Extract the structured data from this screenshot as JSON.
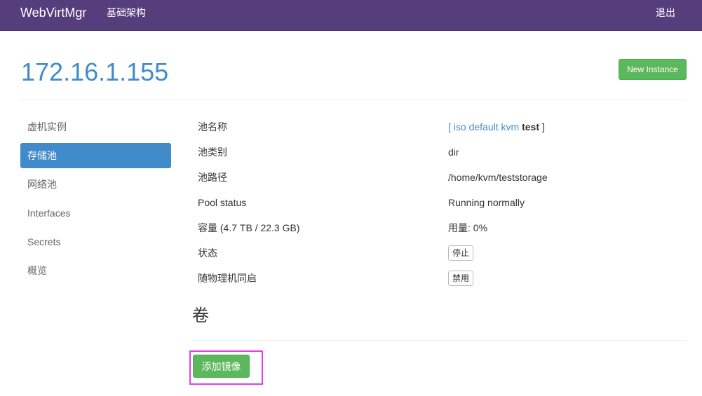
{
  "navbar": {
    "brand": "WebVirtMgr",
    "infrastructure": "基础架构",
    "logout": "退出",
    "color": "#563d7c"
  },
  "header": {
    "host": "172.16.1.155",
    "new_instance_label": "New Instance"
  },
  "sidebar": {
    "items": [
      {
        "label": "虚机实例",
        "active": false
      },
      {
        "label": "存储池",
        "active": true
      },
      {
        "label": "网络池",
        "active": false
      },
      {
        "label": "Interfaces",
        "active": false
      },
      {
        "label": "Secrets",
        "active": false
      },
      {
        "label": "概览",
        "active": false
      }
    ]
  },
  "pool": {
    "name_label": "池名称",
    "pools": [
      "iso",
      "default",
      "kvm"
    ],
    "current_pool": "test",
    "type_label": "池类别",
    "type_value": "dir",
    "path_label": "池路径",
    "path_value": "/home/kvm/teststorage",
    "status_label": "Pool status",
    "status_value": "Running normally",
    "capacity_label": "容量",
    "capacity_value": "(4.7 TB / 22.3 GB)",
    "usage_value": "用量: 0%",
    "state_label": "状态",
    "stop_button": "停止",
    "autostart_label": "随物理机同启",
    "disable_button": "禁用"
  },
  "volumes": {
    "heading": "卷",
    "add_image_button": "添加镜像"
  },
  "colors": {
    "accent": "#428bca",
    "success": "#5cb85c",
    "highlight": "#e53ee5"
  }
}
